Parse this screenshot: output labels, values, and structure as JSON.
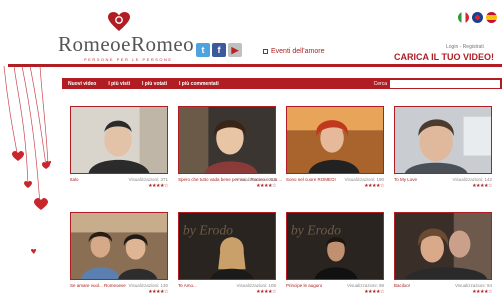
{
  "header": {
    "logo_word": "RomeoeRomeo",
    "logo_tag": "persone per le persone",
    "events_label": "Eventi dell'amore",
    "login_label": "Login - Registrati",
    "upload_label": "CARICA IL TUO VIDEO!",
    "social": [
      "twitter-icon",
      "facebook-icon",
      "youtube-icon"
    ],
    "flags": [
      "italy-flag-icon",
      "uk-flag-icon",
      "spain-flag-icon"
    ],
    "accent": "#b01e24"
  },
  "nav": {
    "tabs": [
      "Nuovi video",
      "I più visti",
      "I più votati",
      "I più commentati"
    ],
    "search_label": "Cerca"
  },
  "videos": [
    {
      "title": "Italo",
      "views": "Visualizzazioni: 371",
      "stars": "★★★★☆"
    },
    {
      "title": "Spero che tutto vada bene per voi... Romeo e sua ...",
      "views": "Visualizzazioni: 233",
      "stars": "★★★★☆"
    },
    {
      "title": "Sono nel cuore ROMEO!",
      "views": "Visualizzazioni: 190",
      "stars": "★★★★☆"
    },
    {
      "title": "To My Love",
      "views": "Visualizzazioni: 142",
      "stars": "★★★★☆"
    },
    {
      "title": "Se amare vuol... Romeoeve",
      "views": "Visualizzazioni: 130",
      "stars": "★★★★☆"
    },
    {
      "title": "Te Amo...",
      "views": "Visualizzazioni: 108",
      "stars": "★★★★☆"
    },
    {
      "title": "Principe le auguro",
      "views": "Visualizzazioni: 98",
      "stars": "★★★★☆"
    },
    {
      "title": "Baciloo!",
      "views": "Visualizzazioni: 94",
      "stars": "★★★★☆"
    }
  ]
}
